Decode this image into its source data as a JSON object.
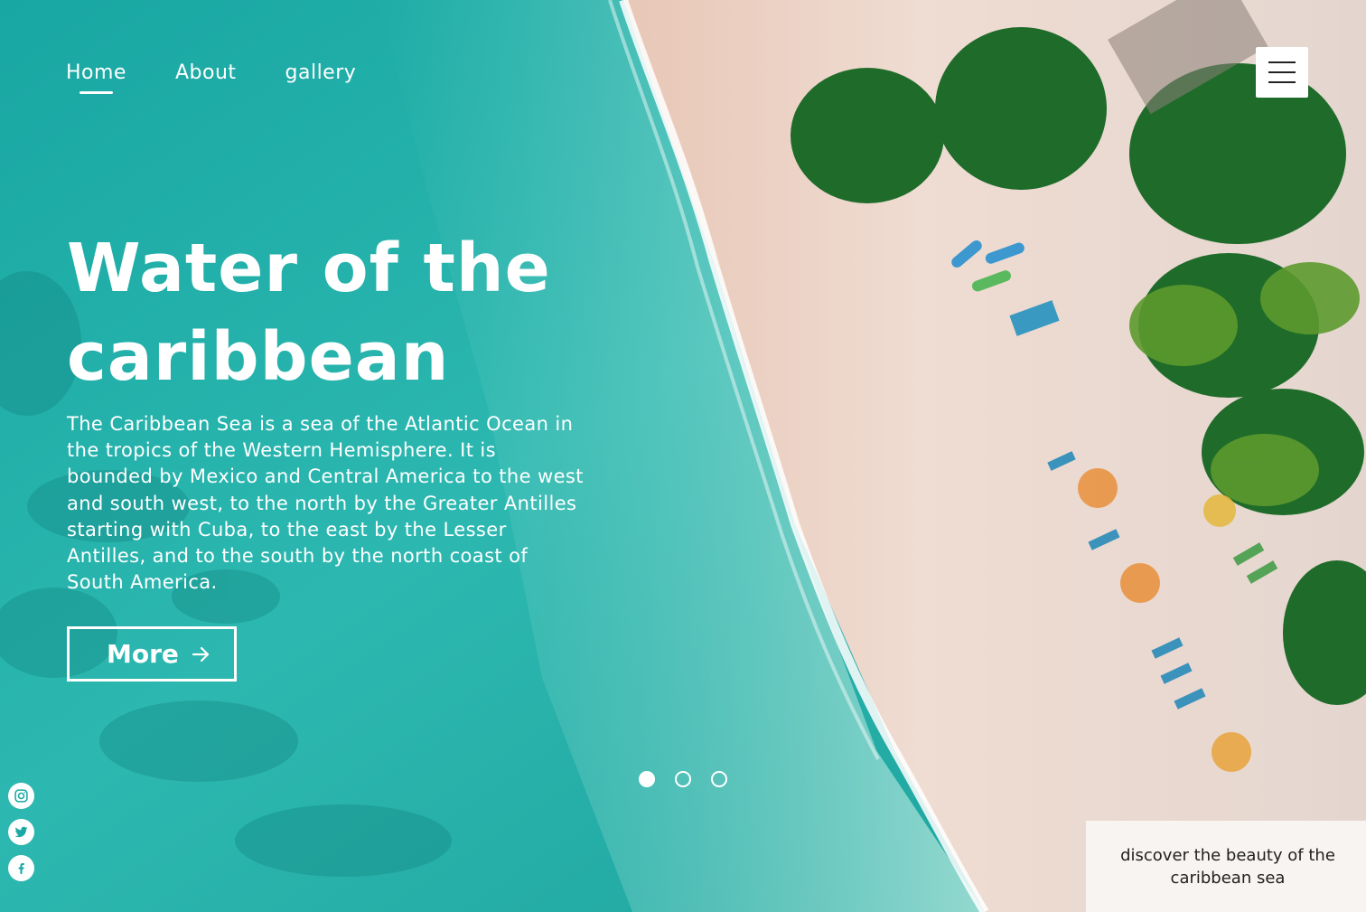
{
  "nav": {
    "items": [
      {
        "label": "Home",
        "active": true
      },
      {
        "label": "About",
        "active": false
      },
      {
        "label": "gallery",
        "active": false
      }
    ]
  },
  "menu_button_icon": "hamburger-menu-icon",
  "hero": {
    "title_line1": "Water of the",
    "title_line2": "caribbean",
    "description": "The Caribbean Sea is a sea of the Atlantic Ocean in the tropics of the Western Hemisphere. It is bounded by Mexico and Central America to the west and south west, to the north by the Greater Antilles starting with Cuba, to the east by the Lesser Antilles, and to the south by the north coast of South America.",
    "more_label": "More",
    "more_icon": "arrow-right-icon"
  },
  "carousel": {
    "count": 3,
    "active_index": 0
  },
  "social": [
    "instagram-icon",
    "twitter-icon",
    "facebook-icon"
  ],
  "caption": "discover the beauty of the caribbean sea",
  "colors": {
    "sea": "#1aa9a4",
    "sand": "#e9d3c6",
    "accent": "#ffffff"
  }
}
